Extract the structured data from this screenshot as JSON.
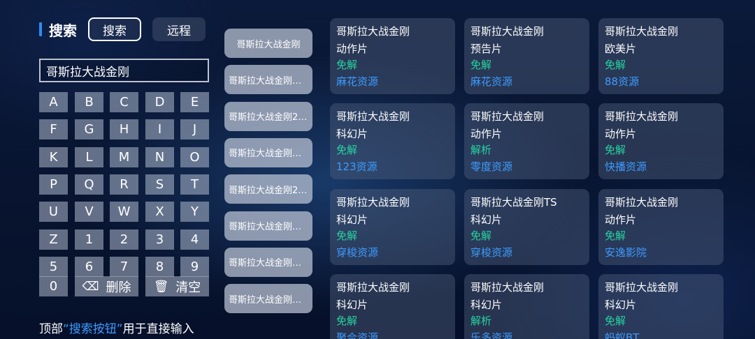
{
  "header": {
    "title": "搜索",
    "search_button": "搜索",
    "remote_button": "远程"
  },
  "search": {
    "query": "哥斯拉大战金刚"
  },
  "keyboard": {
    "rows": [
      [
        "A",
        "B",
        "C",
        "D",
        "E"
      ],
      [
        "F",
        "G",
        "H",
        "I",
        "J"
      ],
      [
        "K",
        "L",
        "M",
        "N",
        "O"
      ],
      [
        "P",
        "Q",
        "R",
        "S",
        "T"
      ],
      [
        "U",
        "V",
        "W",
        "X",
        "Y"
      ],
      [
        "Z",
        "1",
        "2",
        "3",
        "4"
      ],
      [
        "5",
        "6",
        "7",
        "8",
        "9"
      ]
    ],
    "zero_key": "0",
    "delete_label": "删除",
    "delete_icon": "backspace-icon",
    "clear_label": "清空",
    "clear_icon": "trash-icon"
  },
  "hint": {
    "prefix": "顶部",
    "highlight": "“搜索按钮”",
    "suffix": "用于直接输入"
  },
  "suggestions": [
    "哥斯拉大战金刚",
    "哥斯拉大战金刚普...",
    "哥斯拉大战金刚20...",
    "哥斯拉大战金刚机...",
    "哥斯拉大战金刚20...",
    "哥斯拉大战金刚全...",
    "哥斯拉大战金刚普...",
    "哥斯拉大战金刚电..."
  ],
  "results": [
    {
      "name": "哥斯拉大战金刚",
      "category": "动作片",
      "type": "免解",
      "source": "麻花资源"
    },
    {
      "name": "哥斯拉大战金刚",
      "category": "预告片",
      "type": "免解",
      "source": "麻花资源"
    },
    {
      "name": "哥斯拉大战金刚",
      "category": "欧美片",
      "type": "免解",
      "source": "88资源"
    },
    {
      "name": "哥斯拉大战金刚",
      "category": "科幻片",
      "type": "免解",
      "source": "123资源"
    },
    {
      "name": "哥斯拉大战金刚",
      "category": "动作片",
      "type": "解析",
      "source": "零度资源"
    },
    {
      "name": "哥斯拉大战金刚",
      "category": "动作片",
      "type": "免解",
      "source": "快播资源"
    },
    {
      "name": "哥斯拉大战金刚",
      "category": "科幻片",
      "type": "免解",
      "source": "穿梭资源"
    },
    {
      "name": "哥斯拉大战金刚TS",
      "category": "科幻片",
      "type": "免解",
      "source": "穿梭资源"
    },
    {
      "name": "哥斯拉大战金刚",
      "category": "动作片",
      "type": "免解",
      "source": "安逸影院"
    },
    {
      "name": "哥斯拉大战金刚",
      "category": "科幻片",
      "type": "免解",
      "source": "聚合资源"
    },
    {
      "name": "哥斯拉大战金刚",
      "category": "科幻片",
      "type": "解析",
      "source": "乐多资源"
    },
    {
      "name": "哥斯拉大战金刚",
      "category": "科幻片",
      "type": "免解",
      "source": "蚂蚁BT"
    }
  ],
  "colors": {
    "accent": "#3d9bff",
    "free_tag": "#27d3a0",
    "title_bar": "#2d8cf0"
  }
}
